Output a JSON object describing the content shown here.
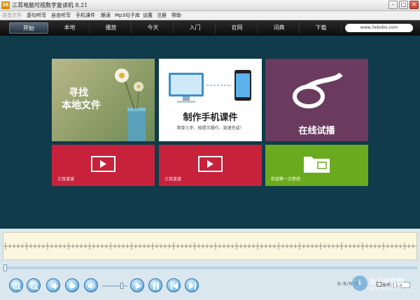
{
  "window": {
    "logo": "3E",
    "title": "三耳电脑可视数字复读机 8.21",
    "minimize_glyph": "–",
    "maximize_glyph": "□",
    "close_glyph": "✕"
  },
  "menu": {
    "items": [
      {
        "label": "录音文件",
        "disabled": true
      },
      {
        "label": "逐句听写",
        "disabled": false
      },
      {
        "label": "自由听写",
        "disabled": false
      },
      {
        "label": "手机课件",
        "disabled": false
      },
      {
        "label": "跟读",
        "disabled": false
      },
      {
        "label": "Mp3句子库",
        "disabled": false
      },
      {
        "label": "设置",
        "disabled": false
      },
      {
        "label": "注册",
        "disabled": false
      },
      {
        "label": "帮助",
        "disabled": false
      }
    ]
  },
  "nav": {
    "tabs": [
      "开始",
      "本地",
      "播放",
      "今天",
      "入门",
      "官网",
      "词典",
      "下载"
    ],
    "active_index": 0,
    "url": "www.3ebobo.com"
  },
  "tiles": {
    "find_local": {
      "line1": "寻找",
      "line2": "本地文件",
      "color": "#9aa870"
    },
    "make_course": {
      "title": "制作手机课件",
      "subtitle": "简单三步，按提示操作，我速完成！",
      "color": "#ffffff"
    },
    "online": {
      "title": "在线试播",
      "color": "#6b3a5f"
    },
    "video1": {
      "caption": "三耳波波",
      "color": "#c8213b"
    },
    "video2": {
      "caption": "三耳波波",
      "color": "#c8213b"
    },
    "welcome": {
      "caption": "欢迎第一次使用",
      "color": "#6aaa1e"
    }
  },
  "player": {
    "time": "0:0/0:0",
    "speed_label": "速率:",
    "speed_value": "1.0",
    "speed_check": "✓",
    "volume_level": 0.75,
    "controls": [
      "zoom-in-icon",
      "zoom-out-icon",
      "prev-icon",
      "next-icon",
      "volume-icon",
      "play-icon",
      "pause-icon",
      "skip-back-icon",
      "skip-forward-icon"
    ]
  },
  "watermark": {
    "badge": "↓",
    "title": "当下软件园",
    "url": "downxia.com"
  }
}
